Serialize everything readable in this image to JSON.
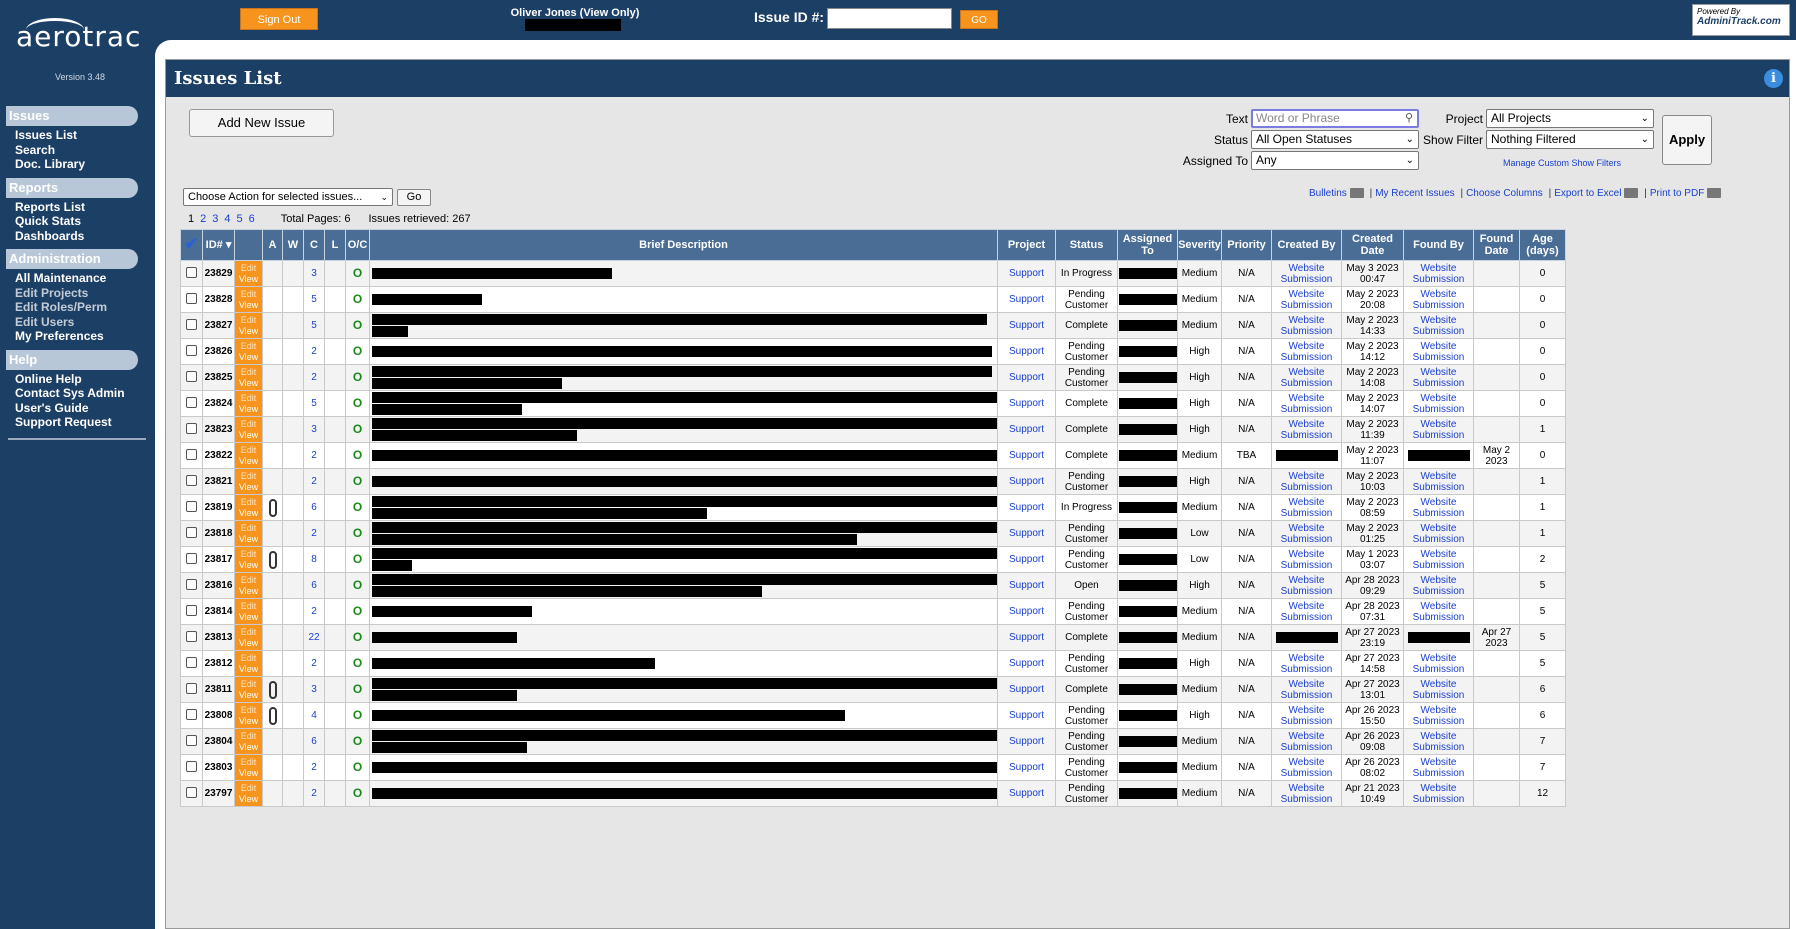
{
  "app": {
    "name": "aerotrac",
    "version": "Version 3.48"
  },
  "header": {
    "signout_label": "Sign Out",
    "user_label": "Oliver Jones (View Only)",
    "issue_id_label": "Issue ID #:",
    "go_label": "GO",
    "powered_by": "Powered By",
    "powered_brand": "AdminiTrack.com"
  },
  "sidebar": {
    "sections": [
      {
        "title": "Issues",
        "items": [
          {
            "label": "Issues List"
          },
          {
            "label": "Search"
          },
          {
            "label": "Doc. Library"
          }
        ]
      },
      {
        "title": "Reports",
        "items": [
          {
            "label": "Reports List"
          },
          {
            "label": "Quick Stats"
          },
          {
            "label": "Dashboards"
          }
        ]
      },
      {
        "title": "Administration",
        "items": [
          {
            "label": "All Maintenance"
          },
          {
            "label": "Edit Projects",
            "disabled": true
          },
          {
            "label": "Edit Roles/Perm",
            "disabled": true
          },
          {
            "label": "Edit Users",
            "disabled": true
          },
          {
            "label": "My Preferences"
          }
        ]
      },
      {
        "title": "Help",
        "items": [
          {
            "label": "Online Help"
          },
          {
            "label": "Contact Sys Admin"
          },
          {
            "label": "User's Guide"
          },
          {
            "label": "Support Request"
          }
        ]
      }
    ]
  },
  "page": {
    "title": "Issues List",
    "info_icon": "info-icon"
  },
  "toolbar": {
    "add_label": "Add New Issue",
    "apply_label": "Apply",
    "manage_filters": "Manage Custom Show Filters"
  },
  "filters": {
    "text_label": "Text",
    "text_placeholder": "Word or Phrase",
    "status_label": "Status",
    "status_value": "All Open Statuses",
    "assigned_label": "Assigned To",
    "assigned_value": "Any",
    "project_label": "Project",
    "project_value": "All Projects",
    "show_label": "Show Filter",
    "show_value": "Nothing Filtered"
  },
  "actions": {
    "select_value": "Choose Action for selected issues...",
    "go_label": "Go"
  },
  "links": {
    "bulletins": "Bulletins",
    "recent": "My Recent Issues",
    "columns": "Choose Columns",
    "excel": "Export to Excel",
    "pdf": "Print to PDF"
  },
  "pager": {
    "pages": [
      "1",
      "2",
      "3",
      "4",
      "5",
      "6"
    ],
    "total": "Total Pages: 6",
    "retrieved": "Issues retrieved: 267"
  },
  "columns": [
    "ID#",
    "A",
    "W",
    "C",
    "L",
    "O/C",
    "Brief Description",
    "Project",
    "Status",
    "Assigned To",
    "Severity",
    "Priority",
    "Created By",
    "Created Date",
    "Found By",
    "Found Date",
    "Age (days)"
  ],
  "rows": [
    {
      "id": "23829",
      "att": false,
      "c": "3",
      "project": "Support",
      "status": "In Progress",
      "severity": "Medium",
      "priority": "N/A",
      "created_by": "Website Submission",
      "created_date": "May 3 2023 00:47",
      "found_by": "Website Submission",
      "found_date": "",
      "age": "0"
    },
    {
      "id": "23828",
      "att": false,
      "c": "5",
      "project": "Support",
      "status": "Pending Customer",
      "severity": "Medium",
      "priority": "N/A",
      "created_by": "Website Submission",
      "created_date": "May 2 2023 20:08",
      "found_by": "Website Submission",
      "found_date": "",
      "age": "0"
    },
    {
      "id": "23827",
      "att": false,
      "c": "5",
      "project": "Support",
      "status": "Complete",
      "severity": "Medium",
      "priority": "N/A",
      "created_by": "Website Submission",
      "created_date": "May 2 2023 14:33",
      "found_by": "Website Submission",
      "found_date": "",
      "age": "0"
    },
    {
      "id": "23826",
      "att": false,
      "c": "2",
      "project": "Support",
      "status": "Pending Customer",
      "severity": "High",
      "priority": "N/A",
      "created_by": "Website Submission",
      "created_date": "May 2 2023 14:12",
      "found_by": "Website Submission",
      "found_date": "",
      "age": "0"
    },
    {
      "id": "23825",
      "att": false,
      "c": "2",
      "project": "Support",
      "status": "Pending Customer",
      "severity": "High",
      "priority": "N/A",
      "created_by": "Website Submission",
      "created_date": "May 2 2023 14:08",
      "found_by": "Website Submission",
      "found_date": "",
      "age": "0"
    },
    {
      "id": "23824",
      "att": false,
      "c": "5",
      "project": "Support",
      "status": "Complete",
      "severity": "High",
      "priority": "N/A",
      "created_by": "Website Submission",
      "created_date": "May 2 2023 14:07",
      "found_by": "Website Submission",
      "found_date": "",
      "age": "0"
    },
    {
      "id": "23823",
      "att": false,
      "c": "3",
      "project": "Support",
      "status": "Complete",
      "severity": "High",
      "priority": "N/A",
      "created_by": "Website Submission",
      "created_date": "May 2 2023 11:39",
      "found_by": "Website Submission",
      "found_date": "",
      "age": "1"
    },
    {
      "id": "23822",
      "att": false,
      "c": "2",
      "project": "Support",
      "status": "Complete",
      "severity": "Medium",
      "priority": "TBA",
      "created_by": "",
      "created_date": "May 2 2023 11:07",
      "found_by": "",
      "found_date": "May 2 2023",
      "age": "0"
    },
    {
      "id": "23821",
      "att": false,
      "c": "2",
      "project": "Support",
      "status": "Pending Customer",
      "severity": "High",
      "priority": "N/A",
      "created_by": "Website Submission",
      "created_date": "May 2 2023 10:03",
      "found_by": "Website Submission",
      "found_date": "",
      "age": "1"
    },
    {
      "id": "23819",
      "att": true,
      "c": "6",
      "project": "Support",
      "status": "In Progress",
      "severity": "Medium",
      "priority": "N/A",
      "created_by": "Website Submission",
      "created_date": "May 2 2023 08:59",
      "found_by": "Website Submission",
      "found_date": "",
      "age": "1"
    },
    {
      "id": "23818",
      "att": false,
      "c": "2",
      "project": "Support",
      "status": "Pending Customer",
      "severity": "Low",
      "priority": "N/A",
      "created_by": "Website Submission",
      "created_date": "May 2 2023 01:25",
      "found_by": "Website Submission",
      "found_date": "",
      "age": "1"
    },
    {
      "id": "23817",
      "att": true,
      "c": "8",
      "project": "Support",
      "status": "Pending Customer",
      "severity": "Low",
      "priority": "N/A",
      "created_by": "Website Submission",
      "created_date": "May 1 2023 03:07",
      "found_by": "Website Submission",
      "found_date": "",
      "age": "2"
    },
    {
      "id": "23816",
      "att": false,
      "c": "6",
      "project": "Support",
      "status": "Open",
      "severity": "High",
      "priority": "N/A",
      "created_by": "Website Submission",
      "created_date": "Apr 28 2023 09:29",
      "found_by": "Website Submission",
      "found_date": "",
      "age": "5"
    },
    {
      "id": "23814",
      "att": false,
      "c": "2",
      "project": "Support",
      "status": "Pending Customer",
      "severity": "Medium",
      "priority": "N/A",
      "created_by": "Website Submission",
      "created_date": "Apr 28 2023 07:31",
      "found_by": "Website Submission",
      "found_date": "",
      "age": "5"
    },
    {
      "id": "23813",
      "att": false,
      "c": "22",
      "project": "Support",
      "status": "Complete",
      "severity": "Medium",
      "priority": "N/A",
      "created_by": "",
      "created_date": "Apr 27 2023 23:19",
      "found_by": "",
      "found_date": "Apr 27 2023",
      "age": "5"
    },
    {
      "id": "23812",
      "att": false,
      "c": "2",
      "project": "Support",
      "status": "Pending Customer",
      "severity": "High",
      "priority": "N/A",
      "created_by": "Website Submission",
      "created_date": "Apr 27 2023 14:58",
      "found_by": "Website Submission",
      "found_date": "",
      "age": "5"
    },
    {
      "id": "23811",
      "att": true,
      "c": "3",
      "project": "Support",
      "status": "Complete",
      "severity": "Medium",
      "priority": "N/A",
      "created_by": "Website Submission",
      "created_date": "Apr 27 2023 13:01",
      "found_by": "Website Submission",
      "found_date": "",
      "age": "6"
    },
    {
      "id": "23808",
      "att": true,
      "c": "4",
      "project": "Support",
      "status": "Pending Customer",
      "severity": "High",
      "priority": "N/A",
      "created_by": "Website Submission",
      "created_date": "Apr 26 2023 15:50",
      "found_by": "Website Submission",
      "found_date": "",
      "age": "6"
    },
    {
      "id": "23804",
      "att": false,
      "c": "6",
      "project": "Support",
      "status": "Pending Customer",
      "severity": "Medium",
      "priority": "N/A",
      "created_by": "Website Submission",
      "created_date": "Apr 26 2023 09:08",
      "found_by": "Website Submission",
      "found_date": "",
      "age": "7"
    },
    {
      "id": "23803",
      "att": false,
      "c": "2",
      "project": "Support",
      "status": "Pending Customer",
      "severity": "Medium",
      "priority": "N/A",
      "created_by": "Website Submission",
      "created_date": "Apr 26 2023 08:02",
      "found_by": "Website Submission",
      "found_date": "",
      "age": "7"
    },
    {
      "id": "23797",
      "att": false,
      "c": "2",
      "project": "Support",
      "status": "Pending Customer",
      "severity": "Medium",
      "priority": "N/A",
      "created_by": "Website Submission",
      "created_date": "Apr 21 2023 10:49",
      "found_by": "Website Submission",
      "found_date": "",
      "age": "12"
    }
  ],
  "row_labels": {
    "edit": "Edit",
    "view": "View",
    "oc": "O"
  },
  "colors": {
    "navy": "#1c3f66",
    "orange": "#f7941e",
    "header_blue": "#4a6d96",
    "link": "#1a3fd0",
    "open_green": "#1b8a1b"
  }
}
